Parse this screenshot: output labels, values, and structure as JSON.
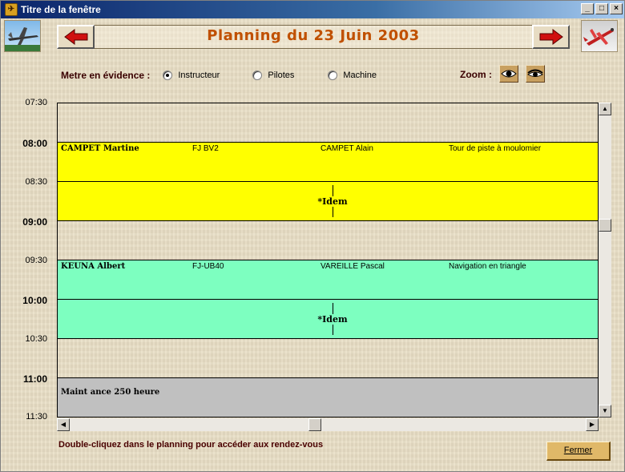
{
  "window": {
    "title": "Titre de la fenêtre",
    "controls": [
      "_",
      "□",
      "×"
    ]
  },
  "header": {
    "title": "Planning du 23 Juin 2003"
  },
  "highlight": {
    "label": "Metre en évidence :",
    "options": [
      {
        "label": "Instructeur",
        "selected": true
      },
      {
        "label": "Pilotes",
        "selected": false
      },
      {
        "label": "Machine",
        "selected": false
      }
    ]
  },
  "zoom": {
    "label": "Zoom :",
    "buttons": [
      "zoom-in-eye-icon",
      "zoom-out-eye-icon"
    ]
  },
  "times": [
    "07:30",
    "08:00",
    "08:30",
    "09:00",
    "09:30",
    "10:00",
    "10:30",
    "11:00",
    "11:30"
  ],
  "colors": {
    "yellow": "#ffff00",
    "green": "#7dffc0",
    "gray": "#c0c0c0",
    "title_orange": "#c05000"
  },
  "appointments": [
    {
      "instructor": "CAMPET Martine",
      "aircraft": "FJ BV2",
      "pilot": "CAMPET Alain",
      "task": "Tour de piste à moulomier",
      "continuation": "*Idem",
      "color": "#ffff00"
    },
    {
      "instructor": "KEUNA Albert",
      "aircraft": "FJ-UB40",
      "pilot": "VAREILLE Pascal",
      "task": "Navigation en triangle",
      "continuation": "*Idem",
      "color": "#7dffc0"
    },
    {
      "instructor": "Maint ance 250 heure",
      "color": "#c0c0c0"
    }
  ],
  "footer": {
    "hint": "Double-cliquez dans le planning pour accéder aux rendez-vous",
    "close_label": "Fermer"
  }
}
